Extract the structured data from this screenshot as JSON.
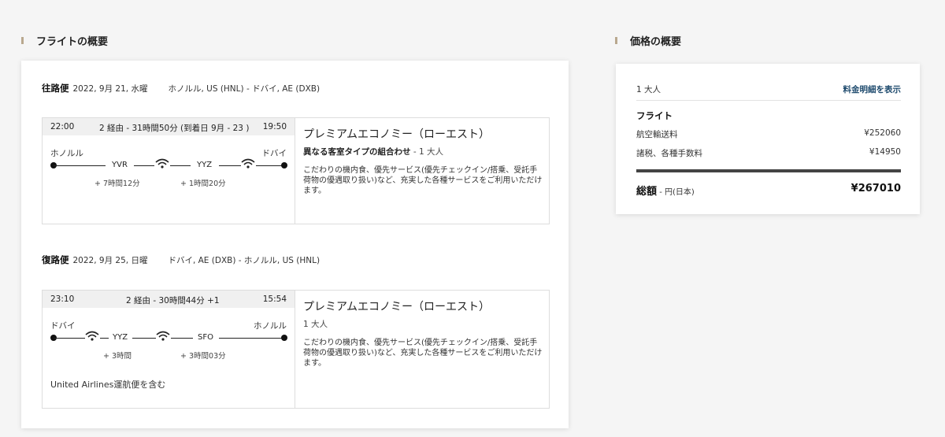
{
  "flight_summary": {
    "title": "フライトの概要",
    "outbound": {
      "direction": "往路便",
      "date": "2022, 9月 21, 水曜",
      "route": "ホノルル, US (HNL) - ドバイ, AE (DXB)",
      "depart_time": "22:00",
      "stops_duration": "2 経由 - 31時間50分 (到着日 9月 - 23 )",
      "arrive_time": "19:50",
      "origin_city": "ホノルル",
      "dest_city": "ドバイ",
      "stop1_code": "YVR",
      "stop2_code": "YYZ",
      "layover1": "+ 7時間12分",
      "layover2": "+ 1時間20分",
      "cabin": "プレミアムエコノミー（ローエスト）",
      "mix_label": "異なる客室タイプの組合わせ",
      "pax": " - 1 大人",
      "description": "こだわりの機内食、優先サービス(優先チェックイン/搭乗、受託手荷物の優遇取り扱い)など、充実した各種サービスをご利用いただけます。"
    },
    "return": {
      "direction": "復路便",
      "date": "2022, 9月 25, 日曜",
      "route": "ドバイ, AE (DXB) - ホノルル, US (HNL)",
      "depart_time": "23:10",
      "stops_duration": "2 経由 - 30時間44分 +1",
      "arrive_time": "15:54",
      "origin_city": "ドバイ",
      "dest_city": "ホノルル",
      "stop1_code": "YYZ",
      "stop2_code": "SFO",
      "layover1": "+ 3時間",
      "layover2": "+ 3時間03分",
      "carrier_note": "United Airlines運航便を含む",
      "cabin": "プレミアムエコノミー（ローエスト）",
      "pax": "1 大人",
      "description": "こだわりの機内食、優先サービス(優先チェックイン/搭乗、受託手荷物の優遇取り扱い)など、充実した各種サービスをご利用いただけます。"
    }
  },
  "price_summary": {
    "title": "価格の概要",
    "pax": "1 大人",
    "details_link": "料金明細を表示",
    "flight_label": "フライト",
    "fare_label": "航空輸送料",
    "fare_value": "¥252060",
    "tax_label": "諸税、各種手数料",
    "tax_value": "¥14950",
    "total_label": "総額",
    "total_currency": " - 円(日本)",
    "total_value": "¥267010"
  },
  "colors": {
    "accent_bar": "#b9a88e",
    "link": "#1f4b6e"
  }
}
